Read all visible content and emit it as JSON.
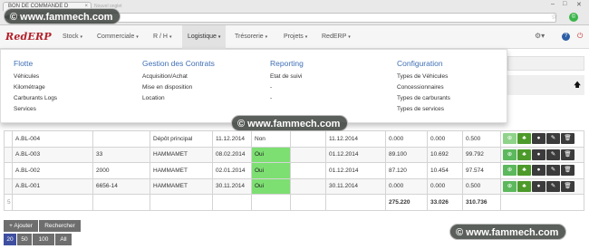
{
  "browser": {
    "tab_title": "BON DE COMMANDE D",
    "tab_close": "×",
    "tab_ghost": "Nouvel onglet",
    "back": "◀",
    "forward": "▶",
    "star": "☆",
    "ext": "©",
    "minimize": "–",
    "maximize": "□",
    "close": "✕"
  },
  "app": {
    "brand": "RedERP",
    "menus": [
      {
        "label": "Stock"
      },
      {
        "label": "Commerciale"
      },
      {
        "label": "R / H"
      },
      {
        "label": "Logistique"
      },
      {
        "label": "Trésorerie"
      },
      {
        "label": "Projets"
      },
      {
        "label": "RedERP"
      }
    ],
    "caret": "▾",
    "gear": "⚙▾",
    "help": "?",
    "power": "⏻"
  },
  "dropdown": {
    "columns": [
      {
        "heading": "Flotte",
        "links": [
          "Véhicules",
          "Kilométrage",
          "Carburants Logs",
          "Services"
        ]
      },
      {
        "heading": "Gestion des Contrats",
        "links": [
          "Acquisition/Achat",
          "Mise en disposition",
          "Location"
        ]
      },
      {
        "heading": "Reporting",
        "links": [
          "Etat de suivi",
          "-",
          "-"
        ]
      },
      {
        "heading": "Configuration",
        "links": [
          "Types de Véhicules",
          "Concessionnaires",
          "Types de carburants",
          "Types de services"
        ]
      }
    ]
  },
  "sort_arrow": "🡅",
  "table": {
    "rows": [
      {
        "num": "",
        "ref": "A.BL-004",
        "c2": "",
        "depot": "Dépôt principal",
        "date": "11.12.2014",
        "flag": "Non",
        "flag_yes": false,
        "c6": "",
        "date2": "11.12.2014",
        "v1": "0.000",
        "v2": "0.000",
        "v3": "0.500"
      },
      {
        "num": "",
        "ref": "A.BL-003",
        "c2": "33",
        "depot": "HAMMAMET",
        "date": "08.02.2014",
        "flag": "Oui",
        "flag_yes": true,
        "c6": "",
        "date2": "01.12.2014",
        "v1": "89.100",
        "v2": "10.692",
        "v3": "99.792"
      },
      {
        "num": "",
        "ref": "A.BL-002",
        "c2": "2000",
        "depot": "HAMMAMET",
        "date": "02.01.2014",
        "flag": "Oui",
        "flag_yes": true,
        "c6": "",
        "date2": "01.12.2014",
        "v1": "87.120",
        "v2": "10.454",
        "v3": "97.574"
      },
      {
        "num": "",
        "ref": "A.BL-001",
        "c2": "6656-14",
        "depot": "HAMMAMET",
        "date": "30.11.2014",
        "flag": "Oui",
        "flag_yes": true,
        "c6": "",
        "date2": "30.11.2014",
        "v1": "0.000",
        "v2": "0.000",
        "v3": "0.500"
      }
    ],
    "totals": {
      "num": "5",
      "v1": "275.220",
      "v2": "33.026",
      "v3": "310.736"
    },
    "action_icons": {
      "view": "⊕",
      "tree": "♣",
      "circle": "●",
      "edit": "✎",
      "delete": "🗑"
    }
  },
  "controls": {
    "add_label": "+ Ajouter",
    "search_label": "Rechercher",
    "page_sizes": [
      "20",
      "50",
      "100",
      "All"
    ]
  },
  "watermark": {
    "text": "© www.fammech.com"
  }
}
